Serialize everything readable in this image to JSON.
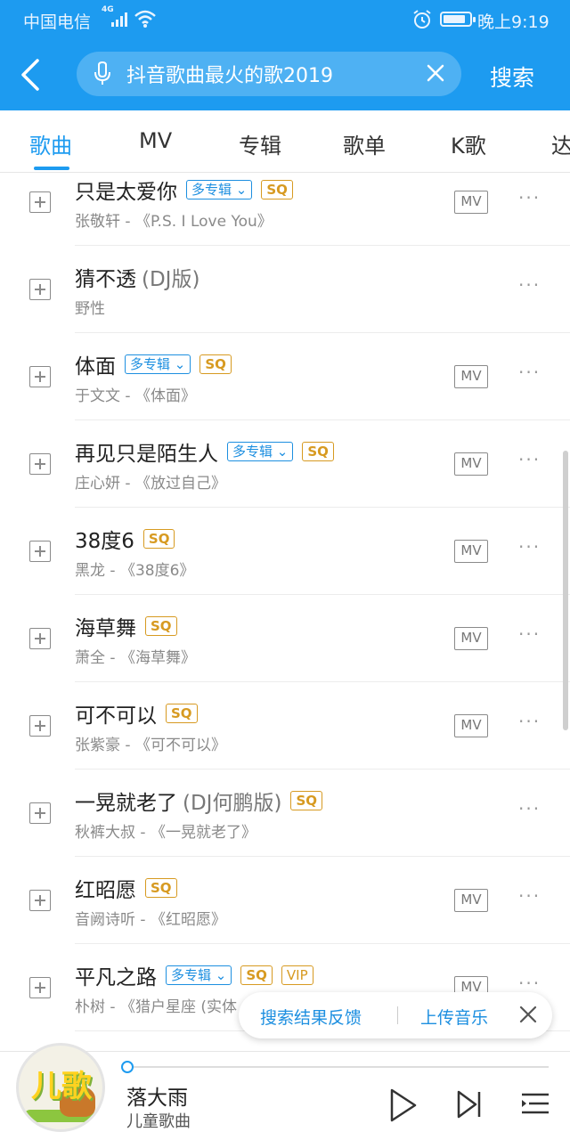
{
  "status": {
    "carrier": "中国电信",
    "network": "4G",
    "time": "晚上9:19"
  },
  "header": {
    "search_query": "抖音歌曲最火的歌2019",
    "search_button": "搜索"
  },
  "tabs": [
    {
      "label": "歌曲",
      "active": true
    },
    {
      "label": "MV"
    },
    {
      "label": "专辑"
    },
    {
      "label": "歌单"
    },
    {
      "label": "K歌"
    },
    {
      "label": "达"
    }
  ],
  "badges": {
    "multi_album": "多专辑",
    "sq": "SQ",
    "vip": "VIP",
    "mv": "MV",
    "more": "···"
  },
  "songs": [
    {
      "title": "只是太爱你",
      "suffix": "",
      "subtitle": "张敬轩 - 《P.S. I Love You》"
    },
    {
      "title": "猜不透",
      "suffix": "(DJ版)",
      "subtitle": "野性"
    },
    {
      "title": "体面",
      "suffix": "",
      "subtitle": "于文文 - 《体面》"
    },
    {
      "title": "再见只是陌生人",
      "suffix": "",
      "subtitle": "庄心妍 - 《放过自己》"
    },
    {
      "title": "38度6",
      "suffix": "",
      "subtitle": "黑龙 - 《38度6》"
    },
    {
      "title": "海草舞",
      "suffix": "",
      "subtitle": "萧全 - 《海草舞》"
    },
    {
      "title": "可不可以",
      "suffix": "",
      "subtitle": "张紫豪 - 《可不可以》"
    },
    {
      "title": "一晃就老了",
      "suffix": "(DJ何鹏版)",
      "subtitle": "秋裤大叔 - 《一晃就老了》"
    },
    {
      "title": "红昭愿",
      "suffix": "",
      "subtitle": "音阙诗听 - 《红昭愿》"
    },
    {
      "title": "平凡之路",
      "suffix": "",
      "subtitle": "朴树 - 《猎户星座 (实体"
    }
  ],
  "feedback": {
    "report_label": "搜索结果反馈",
    "upload_label": "上传音乐"
  },
  "player": {
    "title": "落大雨",
    "artist": "儿童歌曲",
    "art_text": "儿歌",
    "progress": 0.0
  },
  "colors": {
    "brand": "#1d9bf0",
    "sq_badge": "#d79a21",
    "multi_badge": "#1d8fe0"
  }
}
